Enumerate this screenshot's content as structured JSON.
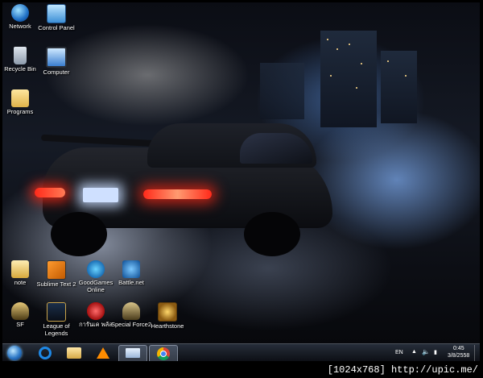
{
  "desktop": {
    "icons": [
      {
        "label": "Network",
        "icon": "network-icon"
      },
      {
        "label": "Control Panel",
        "icon": "control-panel-icon"
      },
      {
        "label": "Recycle Bin",
        "icon": "recycle-bin-icon"
      },
      {
        "label": "Computer",
        "icon": "computer-icon"
      },
      {
        "label": "Programs",
        "icon": "folder-icon"
      },
      {
        "label": "note",
        "icon": "folder-icon"
      },
      {
        "label": "Sublime Text 2",
        "icon": "sublime-text-icon"
      },
      {
        "label": "GoodGames Online",
        "icon": "goodgames-icon"
      },
      {
        "label": "Battle.net",
        "icon": "battlenet-icon"
      },
      {
        "label": "SF",
        "icon": "sf-game-icon"
      },
      {
        "label": "League of Legends",
        "icon": "league-of-legends-icon"
      },
      {
        "label": "การันเค พลัส",
        "icon": "game-app-icon"
      },
      {
        "label": "Special Force2",
        "icon": "special-force2-icon"
      },
      {
        "label": "Hearthstone",
        "icon": "hearthstone-icon"
      }
    ]
  },
  "taskbar": {
    "pinned": [
      "start-orb-icon",
      "internet-explorer-icon",
      "file-explorer-icon",
      "vlc-icon",
      "window-app-icon",
      "chrome-icon"
    ],
    "tray": {
      "language": "EN",
      "time": "0:45",
      "date": "3/8/2558"
    }
  },
  "watermark": "[1024x768] http://upic.me/",
  "colors": {
    "taskbar": "#1a1f2a",
    "chrome_red": "#db4437",
    "ie_blue": "#1e88e5"
  }
}
